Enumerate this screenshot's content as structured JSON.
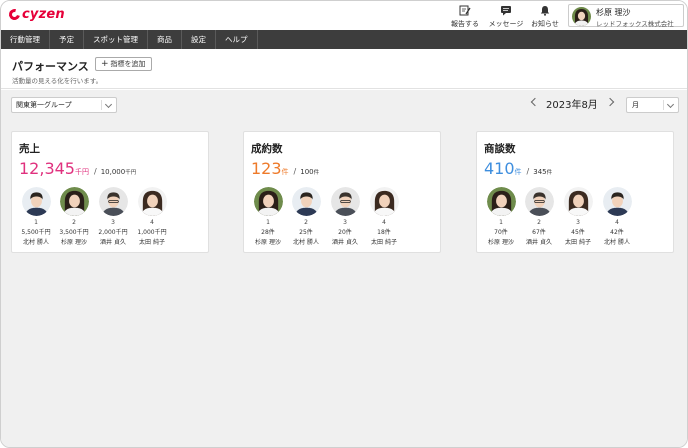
{
  "app": {
    "logo_text": "cyzen",
    "brand_color": "#e60039"
  },
  "toolbar": {
    "report_label": "報告する",
    "message_label": "メッセージ",
    "notice_label": "お知らせ",
    "report_icon": "pencil-note-icon",
    "message_icon": "chat-icon",
    "notice_icon": "bell-icon"
  },
  "user": {
    "name": "杉原 理沙",
    "company": "レッドフォックス株式会社"
  },
  "nav": {
    "items": [
      "行動管理",
      "予定",
      "スポット管理",
      "商品",
      "設定",
      "ヘルプ"
    ]
  },
  "header": {
    "title": "パフォーマンス",
    "add_button": "指標を追加",
    "subtitle": "活動量の見える化を行います。"
  },
  "filters": {
    "group": "関東第一グループ",
    "date": "2023年8月",
    "period": "月"
  },
  "cards": [
    {
      "title": "売上",
      "value": "12,345",
      "unit": "千円",
      "target": "10,000",
      "target_unit": "千円",
      "color": "#e0317e",
      "ranking": [
        {
          "rank": "1",
          "value": "5,500千円",
          "name": "北村 勝人",
          "avatar": "male"
        },
        {
          "rank": "2",
          "value": "3,500千円",
          "name": "杉原 理沙",
          "avatar": "female"
        },
        {
          "rank": "3",
          "value": "2,000千円",
          "name": "酒井 貞久",
          "avatar": "male2"
        },
        {
          "rank": "4",
          "value": "1,000千円",
          "name": "太田 純子",
          "avatar": "female2"
        }
      ]
    },
    {
      "title": "成約数",
      "value": "123",
      "unit": "件",
      "target": "100",
      "target_unit": "件",
      "color": "#ee7a2a",
      "ranking": [
        {
          "rank": "1",
          "value": "28件",
          "name": "杉原 理沙",
          "avatar": "female"
        },
        {
          "rank": "2",
          "value": "25件",
          "name": "北村 勝人",
          "avatar": "male"
        },
        {
          "rank": "3",
          "value": "20件",
          "name": "酒井 貞久",
          "avatar": "male2"
        },
        {
          "rank": "4",
          "value": "18件",
          "name": "太田 純子",
          "avatar": "female2"
        }
      ]
    },
    {
      "title": "商談数",
      "value": "410",
      "unit": "件",
      "target": "345",
      "target_unit": "件",
      "color": "#3e8ede",
      "ranking": [
        {
          "rank": "1",
          "value": "70件",
          "name": "杉原 理沙",
          "avatar": "female"
        },
        {
          "rank": "2",
          "value": "67件",
          "name": "酒井 貞久",
          "avatar": "male2"
        },
        {
          "rank": "3",
          "value": "45件",
          "name": "太田 純子",
          "avatar": "female2"
        },
        {
          "rank": "4",
          "value": "42件",
          "name": "北村 勝人",
          "avatar": "male"
        }
      ]
    }
  ]
}
